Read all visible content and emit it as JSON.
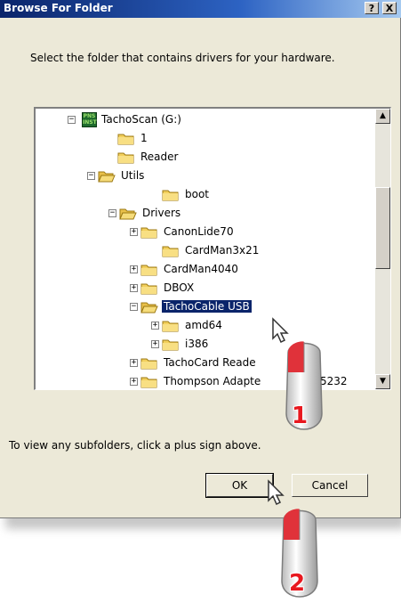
{
  "window": {
    "title": "Browse For Folder",
    "help_label": "?",
    "close_label": "X"
  },
  "instruction": "Select the folder that contains drivers for your hardware.",
  "tree": {
    "items": [
      {
        "label": "TachoScan (G:)",
        "icon": "drive-icon",
        "expander": "−"
      },
      {
        "label": "1",
        "icon": "folder-icon",
        "expander": ""
      },
      {
        "label": "Reader",
        "icon": "folder-icon",
        "expander": ""
      },
      {
        "label": "Utils",
        "icon": "folder-open-icon",
        "expander": "−"
      },
      {
        "label": "boot",
        "icon": "folder-icon",
        "expander": ""
      },
      {
        "label": "Drivers",
        "icon": "folder-open-icon",
        "expander": "−"
      },
      {
        "label": "CanonLide70",
        "icon": "folder-icon",
        "expander": "+"
      },
      {
        "label": "CardMan3x21",
        "icon": "folder-icon",
        "expander": ""
      },
      {
        "label": "CardMan4040",
        "icon": "folder-icon",
        "expander": "+"
      },
      {
        "label": "DBOX",
        "icon": "folder-icon",
        "expander": "+"
      },
      {
        "label": "TachoCable USB",
        "icon": "folder-open-icon",
        "expander": "−",
        "selected": true
      },
      {
        "label": "amd64",
        "icon": "folder-icon",
        "expander": "+"
      },
      {
        "label": "i386",
        "icon": "folder-icon",
        "expander": "+"
      },
      {
        "label": "TachoCard Reade",
        "icon": "folder-icon",
        "expander": "+"
      },
      {
        "label": "Thompson Adapte",
        "icon": "folder-icon",
        "expander": "+",
        "suffix": "5232"
      }
    ]
  },
  "hint": "To view any subfolders, click a plus sign above.",
  "buttons": {
    "ok": "OK",
    "cancel": "Cancel"
  },
  "steps": {
    "one": "1",
    "two": "2"
  },
  "colors": {
    "title_bar": "#0a246a",
    "selection": "#0a246a",
    "step_number": "#e8181f",
    "mouse_accent": "#e0323a"
  }
}
